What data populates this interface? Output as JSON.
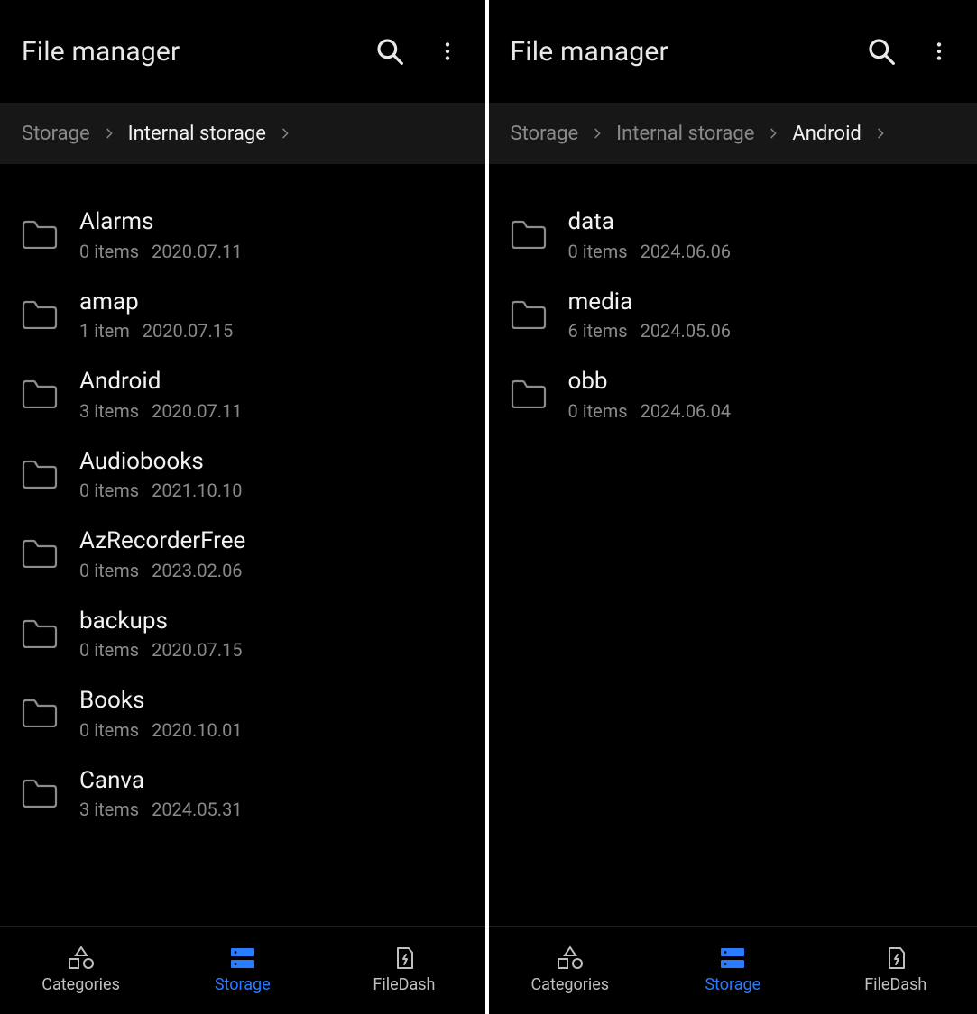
{
  "app_title": "File manager",
  "left": {
    "breadcrumb": [
      {
        "label": "Storage",
        "active": false
      },
      {
        "label": "Internal storage",
        "active": true
      }
    ],
    "items": [
      {
        "name": "Alarms",
        "items": "0 items",
        "date": "2020.07.11"
      },
      {
        "name": "amap",
        "items": "1 item",
        "date": "2020.07.15"
      },
      {
        "name": "Android",
        "items": "3 items",
        "date": "2020.07.11"
      },
      {
        "name": "Audiobooks",
        "items": "0 items",
        "date": "2021.10.10"
      },
      {
        "name": "AzRecorderFree",
        "items": "0 items",
        "date": "2023.02.06"
      },
      {
        "name": "backups",
        "items": "0 items",
        "date": "2020.07.15"
      },
      {
        "name": "Books",
        "items": "0 items",
        "date": "2020.10.01"
      },
      {
        "name": "Canva",
        "items": "3 items",
        "date": "2024.05.31"
      }
    ]
  },
  "right": {
    "breadcrumb": [
      {
        "label": "Storage",
        "active": false
      },
      {
        "label": "Internal storage",
        "active": false
      },
      {
        "label": "Android",
        "active": true
      }
    ],
    "items": [
      {
        "name": "data",
        "items": "0 items",
        "date": "2024.06.06"
      },
      {
        "name": "media",
        "items": "6 items",
        "date": "2024.05.06"
      },
      {
        "name": "obb",
        "items": "0 items",
        "date": "2024.06.04"
      }
    ]
  },
  "bottom_nav": [
    {
      "label": "Categories",
      "icon": "categories",
      "active": false
    },
    {
      "label": "Storage",
      "icon": "storage",
      "active": true
    },
    {
      "label": "FileDash",
      "icon": "filedash",
      "active": false
    }
  ]
}
